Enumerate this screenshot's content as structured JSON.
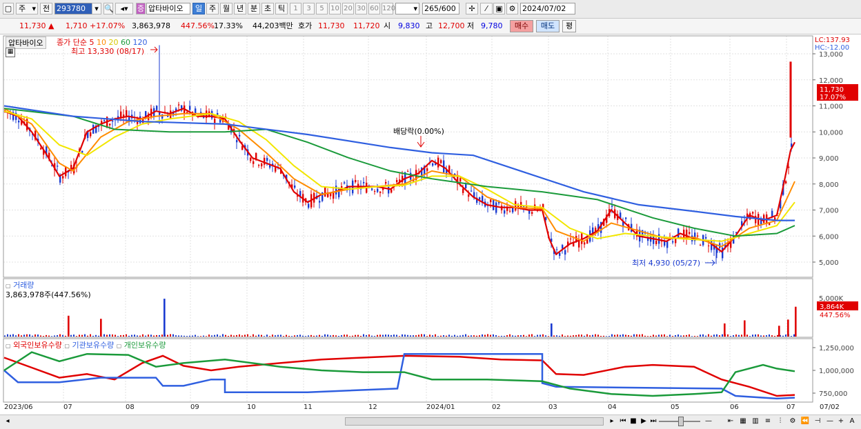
{
  "toolbar": {
    "market_label": "주",
    "prev_label": "전",
    "stock_code": "293780",
    "stock_name": "압타바이오",
    "badge": "증",
    "periods": [
      "일",
      "주",
      "월",
      "년",
      "분",
      "초",
      "틱"
    ],
    "active_period": "일",
    "minute_options": [
      "1",
      "3",
      "5",
      "10",
      "20",
      "30",
      "60",
      "120"
    ],
    "count": "265",
    "count_total": "/600",
    "date": "2024/07/02"
  },
  "quote": {
    "price": "11,730",
    "change": "1,710",
    "change_pct": "+17.07%",
    "volume": "3,863,978",
    "vol_ratio": "447.56%",
    "turnover": "17.33%",
    "amount": "44,203백만",
    "hoga_label": "호가",
    "hoga_ask": "11,730",
    "hoga_bid": "11,720",
    "open_label": "시",
    "open": "9,830",
    "high_label": "고",
    "high": "12,700",
    "low_label": "저",
    "low": "9,780",
    "buy_label": "매수",
    "sell_label": "매도",
    "avg_label": "평"
  },
  "price_panel": {
    "name": "압타바이오",
    "legend_prefix": "종가 단순 5",
    "ma_labels": [
      "10",
      "20",
      "60",
      "120"
    ],
    "ma_colors": [
      "#e00000",
      "#ff8c00",
      "#f2e600",
      "#1a9a3a",
      "#2f5fe0"
    ],
    "high_marker": "최고 13,330 (08/17)",
    "low_marker": "최저 4,930 (05/27)",
    "dividend": "배당락(0.00%)",
    "lc": "LC:137.93",
    "hc": "HC:-12.00",
    "ticks": [
      "13,000",
      "12,000",
      "11,000",
      "10,000",
      "9,000",
      "8,000",
      "7,000",
      "6,000",
      "5,000"
    ],
    "current_price": "11,730",
    "current_pct": "17.07%"
  },
  "volume_panel": {
    "title": "거래량",
    "value": "3,863,978주(447.56%)",
    "tick": "5,000K",
    "current": "3,864K",
    "current_pct": "447.56%"
  },
  "holding_panel": {
    "legend": [
      {
        "name": "외국인보유수량",
        "color": "#e00000"
      },
      {
        "name": "기관보유수량",
        "color": "#2f5fe0"
      },
      {
        "name": "개인보유수량",
        "color": "#1a9a3a"
      }
    ],
    "ticks": [
      "1,250,000",
      "1,000,000",
      "750,000"
    ]
  },
  "x_axis": {
    "months": [
      "2023/06",
      "07",
      "08",
      "09",
      "10",
      "11",
      "12",
      "2024/01",
      "02",
      "03",
      "04",
      "05",
      "06",
      "07"
    ],
    "right_label": "07/02"
  },
  "chart_data": {
    "type": "line",
    "title": "",
    "price_ma": [
      {
        "name": "5",
        "points": [
          [
            0,
            10800
          ],
          [
            20,
            10600
          ],
          [
            40,
            10000
          ],
          [
            60,
            9200
          ],
          [
            80,
            8300
          ],
          [
            100,
            8600
          ],
          [
            120,
            10000
          ],
          [
            140,
            10300
          ],
          [
            160,
            10500
          ],
          [
            180,
            10600
          ],
          [
            200,
            10500
          ],
          [
            220,
            10800
          ],
          [
            240,
            10700
          ],
          [
            260,
            10900
          ],
          [
            280,
            10600
          ],
          [
            300,
            10600
          ],
          [
            320,
            10500
          ],
          [
            340,
            9700
          ],
          [
            360,
            9000
          ],
          [
            380,
            8800
          ],
          [
            400,
            8600
          ],
          [
            420,
            7700
          ],
          [
            440,
            7300
          ],
          [
            460,
            7600
          ],
          [
            480,
            7700
          ],
          [
            500,
            7900
          ],
          [
            520,
            7900
          ],
          [
            540,
            7900
          ],
          [
            560,
            7800
          ],
          [
            580,
            8200
          ],
          [
            600,
            8400
          ],
          [
            620,
            8900
          ],
          [
            640,
            8600
          ],
          [
            660,
            8000
          ],
          [
            680,
            7500
          ],
          [
            700,
            7200
          ],
          [
            720,
            7100
          ],
          [
            740,
            7100
          ],
          [
            760,
            7000
          ],
          [
            780,
            7000
          ],
          [
            790,
            5900
          ],
          [
            800,
            5300
          ],
          [
            820,
            5700
          ],
          [
            840,
            5900
          ],
          [
            860,
            6200
          ],
          [
            880,
            7000
          ],
          [
            900,
            6500
          ],
          [
            920,
            6000
          ],
          [
            940,
            5900
          ],
          [
            960,
            5800
          ],
          [
            980,
            6100
          ],
          [
            1000,
            5900
          ],
          [
            1020,
            5800
          ],
          [
            1040,
            5400
          ],
          [
            1060,
            6000
          ],
          [
            1080,
            6800
          ],
          [
            1100,
            6600
          ],
          [
            1120,
            6800
          ],
          [
            1130,
            8000
          ],
          [
            1140,
            9300
          ],
          [
            1146,
            9600
          ]
        ]
      },
      {
        "name": "10",
        "points": [
          [
            0,
            10900
          ],
          [
            40,
            10300
          ],
          [
            80,
            8800
          ],
          [
            100,
            8500
          ],
          [
            140,
            9800
          ],
          [
            180,
            10400
          ],
          [
            220,
            10600
          ],
          [
            260,
            10700
          ],
          [
            300,
            10700
          ],
          [
            340,
            10100
          ],
          [
            380,
            9200
          ],
          [
            420,
            8200
          ],
          [
            460,
            7600
          ],
          [
            500,
            7800
          ],
          [
            540,
            7900
          ],
          [
            580,
            8000
          ],
          [
            620,
            8500
          ],
          [
            660,
            8300
          ],
          [
            700,
            7500
          ],
          [
            740,
            7100
          ],
          [
            780,
            7050
          ],
          [
            800,
            6200
          ],
          [
            840,
            5800
          ],
          [
            880,
            6500
          ],
          [
            920,
            6200
          ],
          [
            960,
            5900
          ],
          [
            1000,
            5950
          ],
          [
            1040,
            5600
          ],
          [
            1080,
            6300
          ],
          [
            1120,
            6600
          ],
          [
            1146,
            8100
          ]
        ]
      },
      {
        "name": "20",
        "points": [
          [
            0,
            10800
          ],
          [
            40,
            10500
          ],
          [
            80,
            9500
          ],
          [
            120,
            9100
          ],
          [
            160,
            9800
          ],
          [
            200,
            10300
          ],
          [
            240,
            10500
          ],
          [
            300,
            10700
          ],
          [
            340,
            10400
          ],
          [
            380,
            9700
          ],
          [
            420,
            8700
          ],
          [
            460,
            7900
          ],
          [
            500,
            7800
          ],
          [
            540,
            7900
          ],
          [
            580,
            7950
          ],
          [
            620,
            8300
          ],
          [
            660,
            8300
          ],
          [
            700,
            7800
          ],
          [
            740,
            7200
          ],
          [
            780,
            7100
          ],
          [
            820,
            6300
          ],
          [
            860,
            5900
          ],
          [
            900,
            6100
          ],
          [
            940,
            6000
          ],
          [
            980,
            5900
          ],
          [
            1040,
            5800
          ],
          [
            1080,
            6100
          ],
          [
            1120,
            6400
          ],
          [
            1146,
            7300
          ]
        ]
      },
      {
        "name": "60",
        "points": [
          [
            0,
            10900
          ],
          [
            100,
            10600
          ],
          [
            160,
            10100
          ],
          [
            240,
            10000
          ],
          [
            320,
            10000
          ],
          [
            380,
            10100
          ],
          [
            440,
            9600
          ],
          [
            500,
            9000
          ],
          [
            560,
            8500
          ],
          [
            620,
            8200
          ],
          [
            700,
            7900
          ],
          [
            780,
            7700
          ],
          [
            860,
            7400
          ],
          [
            940,
            6700
          ],
          [
            1000,
            6300
          ],
          [
            1060,
            6000
          ],
          [
            1120,
            6100
          ],
          [
            1146,
            6400
          ]
        ]
      },
      {
        "name": "120",
        "points": [
          [
            0,
            11000
          ],
          [
            100,
            10600
          ],
          [
            200,
            10400
          ],
          [
            320,
            10300
          ],
          [
            440,
            9900
          ],
          [
            560,
            9400
          ],
          [
            620,
            9200
          ],
          [
            680,
            9100
          ],
          [
            760,
            8400
          ],
          [
            840,
            7700
          ],
          [
            920,
            7200
          ],
          [
            1000,
            6950
          ],
          [
            1060,
            6750
          ],
          [
            1120,
            6600
          ],
          [
            1146,
            6600
          ]
        ]
      }
    ],
    "holdings": [
      {
        "name": "외국인보유수량",
        "points": [
          [
            0,
            1140000
          ],
          [
            40,
            1030000
          ],
          [
            80,
            920000
          ],
          [
            120,
            960000
          ],
          [
            160,
            900000
          ],
          [
            200,
            1080000
          ],
          [
            230,
            1160000
          ],
          [
            260,
            1050000
          ],
          [
            300,
            1000000
          ],
          [
            340,
            1040000
          ],
          [
            400,
            1080000
          ],
          [
            460,
            1120000
          ],
          [
            520,
            1140000
          ],
          [
            580,
            1160000
          ],
          [
            660,
            1150000
          ],
          [
            720,
            1120000
          ],
          [
            780,
            1110000
          ],
          [
            800,
            960000
          ],
          [
            840,
            950000
          ],
          [
            900,
            1040000
          ],
          [
            940,
            1060000
          ],
          [
            1000,
            1040000
          ],
          [
            1040,
            900000
          ],
          [
            1080,
            820000
          ],
          [
            1120,
            720000
          ],
          [
            1146,
            730000
          ]
        ]
      },
      {
        "name": "기관보유수량",
        "points": [
          [
            0,
            1000000
          ],
          [
            20,
            870000
          ],
          [
            80,
            870000
          ],
          [
            140,
            920000
          ],
          [
            220,
            920000
          ],
          [
            230,
            830000
          ],
          [
            260,
            830000
          ],
          [
            300,
            900000
          ],
          [
            320,
            900000
          ],
          [
            320,
            760000
          ],
          [
            440,
            760000
          ],
          [
            570,
            800000
          ],
          [
            570,
            800000
          ],
          [
            580,
            1180000
          ],
          [
            780,
            1180000
          ],
          [
            780,
            860000
          ],
          [
            800,
            820000
          ],
          [
            1040,
            800000
          ],
          [
            1060,
            720000
          ],
          [
            1120,
            690000
          ],
          [
            1146,
            700000
          ]
        ]
      },
      {
        "name": "개인보유수량",
        "points": [
          [
            0,
            1000000
          ],
          [
            40,
            1200000
          ],
          [
            80,
            1100000
          ],
          [
            120,
            1180000
          ],
          [
            180,
            1170000
          ],
          [
            220,
            1040000
          ],
          [
            260,
            1080000
          ],
          [
            320,
            1120000
          ],
          [
            400,
            1040000
          ],
          [
            460,
            1000000
          ],
          [
            520,
            980000
          ],
          [
            580,
            980000
          ],
          [
            620,
            900000
          ],
          [
            700,
            900000
          ],
          [
            780,
            880000
          ],
          [
            820,
            800000
          ],
          [
            880,
            740000
          ],
          [
            940,
            720000
          ],
          [
            1000,
            740000
          ],
          [
            1040,
            760000
          ],
          [
            1060,
            980000
          ],
          [
            1100,
            1060000
          ],
          [
            1120,
            1020000
          ],
          [
            1146,
            990000
          ]
        ]
      }
    ],
    "volume_spikes_k": [
      [
        92,
        2700
      ],
      [
        139,
        2300
      ],
      [
        231,
        4900
      ],
      [
        792,
        1700
      ],
      [
        1043,
        1700
      ],
      [
        1072,
        2100
      ],
      [
        1122,
        1400
      ],
      [
        1135,
        2200
      ],
      [
        1146,
        3864
      ]
    ]
  }
}
